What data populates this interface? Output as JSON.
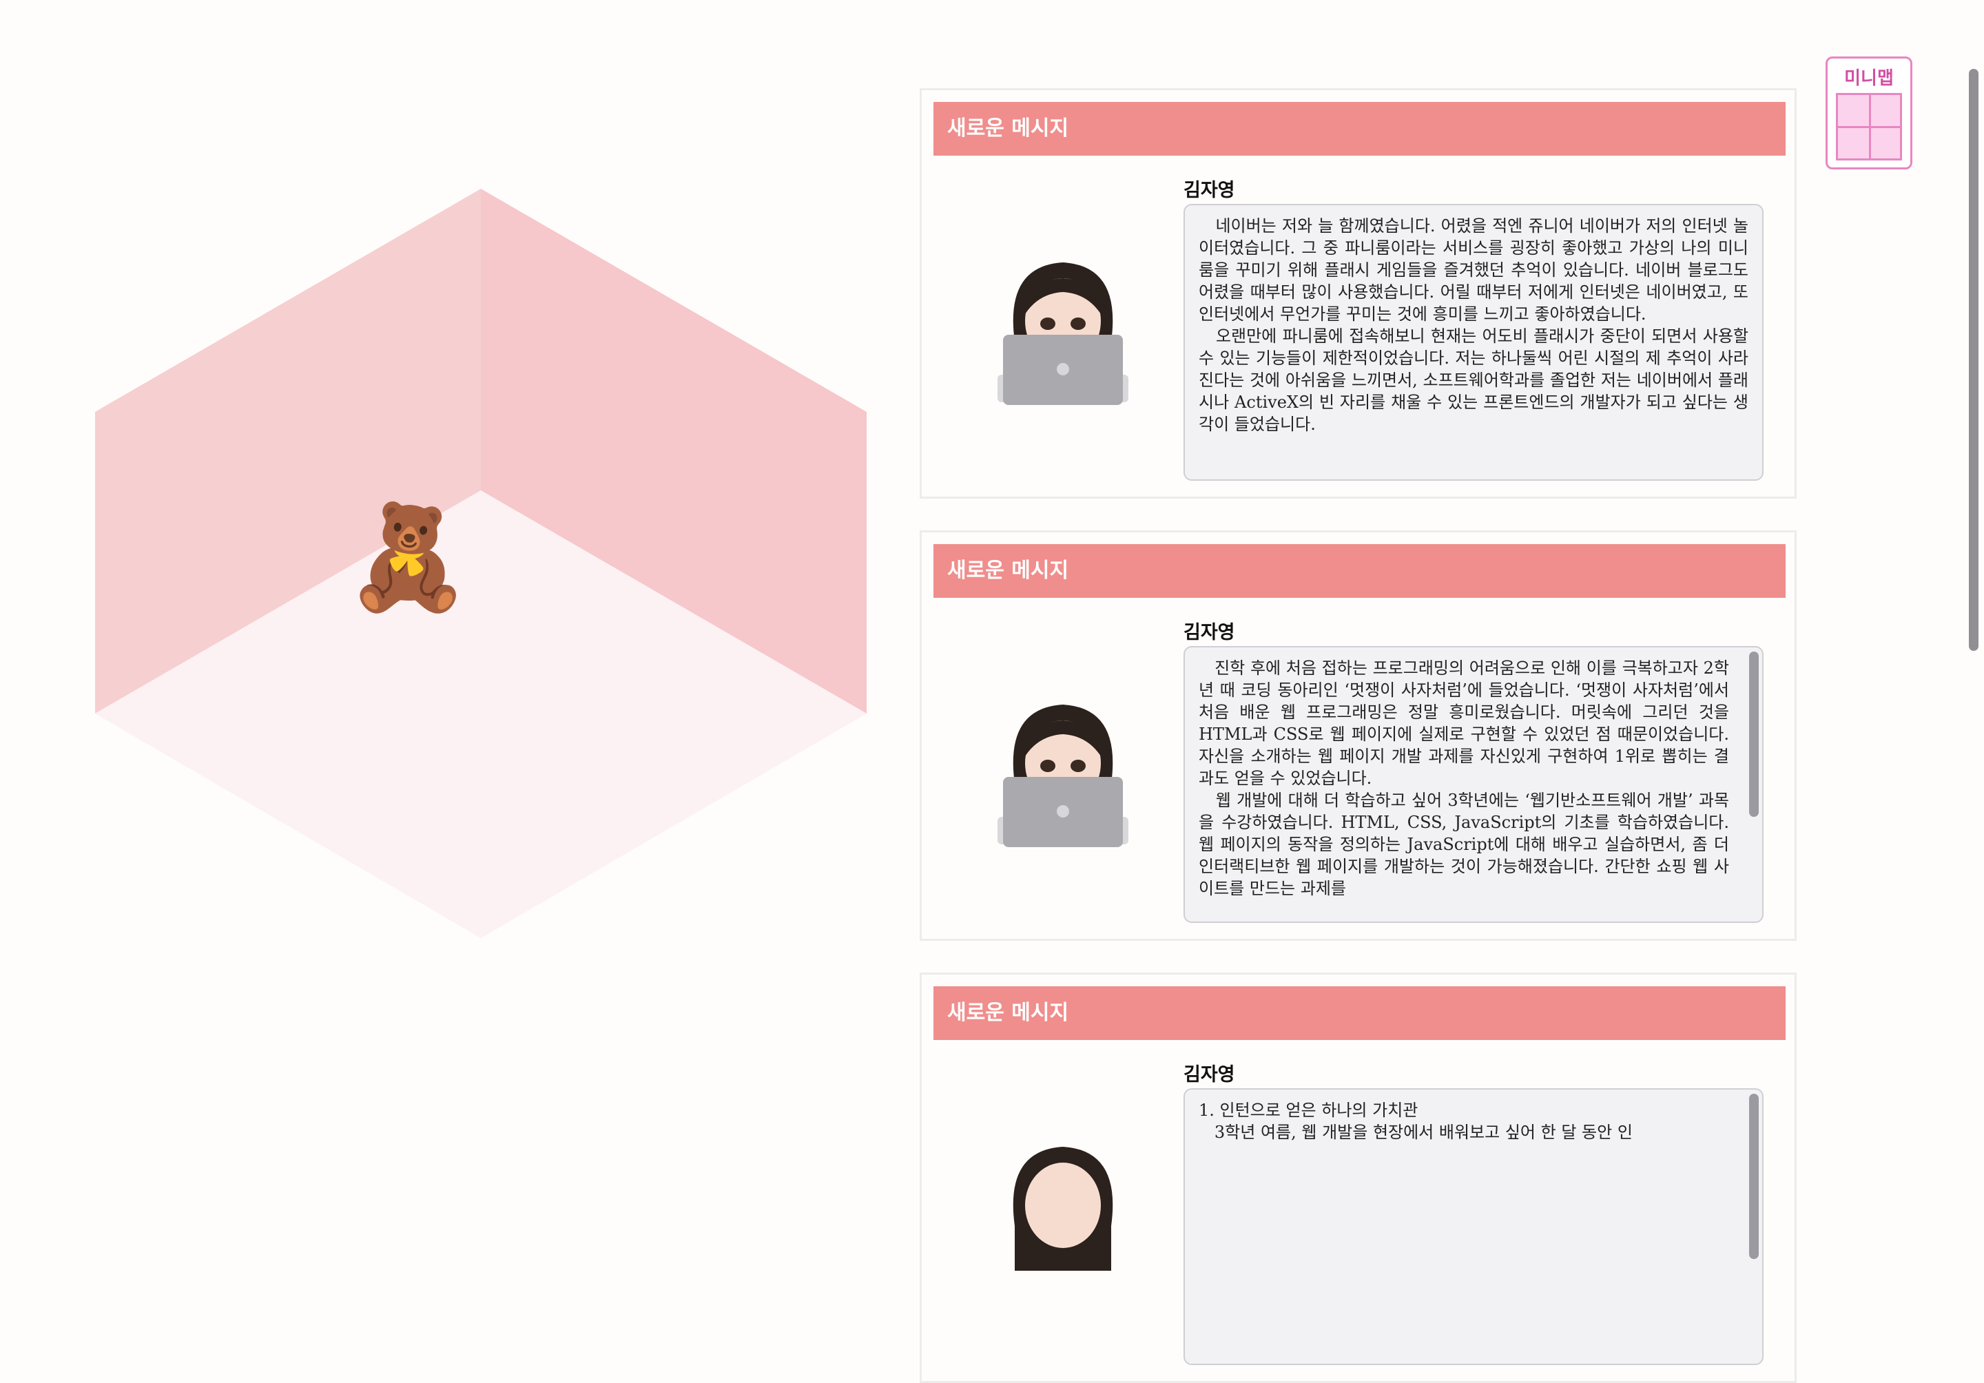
{
  "room": {
    "item_icon": "teddy-bear-icon",
    "item_glyph": "🧸"
  },
  "minimap": {
    "title": "미니맵"
  },
  "messages": [
    {
      "header": "새로운 메시지",
      "sender": "김자영",
      "avatar": "memoji-laptop-avatar",
      "text": "   네이버는 저와 늘 함께였습니다. 어렸을 적엔 쥬니어 네이버가 저의 인터넷 놀이터였습니다. 그 중 파니룸이라는 서비스를 굉장히 좋아했고 가상의 나의 미니 룸을 꾸미기 위해 플래시 게임들을 즐겨했던 추억이 있습니다. 네이버 블로그도 어렸을 때부터 많이 사용했습니다. 어릴 때부터 저에게 인터넷은 네이버였고, 또 인터넷에서 무언가를 꾸미는 것에 흥미를 느끼고 좋아하였습니다.\n   오랜만에 파니룸에 접속해보니 현재는 어도비 플래시가 중단이 되면서 사용할 수 있는 기능들이 제한적이었습니다. 저는 하나둘씩 어린 시절의 제 추억이 사라진다는 것에 아쉬움을 느끼면서, 소프트웨어학과를 졸업한 저는 네이버에서 플래시나 ActiveX의 빈 자리를 채울 수 있는 프론트엔드의 개발자가 되고 싶다는 생각이 들었습니다.",
      "scroll": false
    },
    {
      "header": "새로운 메시지",
      "sender": "김자영",
      "avatar": "memoji-laptop-avatar",
      "text": "   진학 후에 처음 접하는 프로그래밍의 어려움으로 인해 이를 극복하고자 2학년 때 코딩 동아리인 ‘멋쟁이 사자처럼’에 들었습니다. ‘멋쟁이 사자처럼’에서 처음 배운 웹 프로그래밍은 정말 흥미로웠습니다. 머릿속에 그리던 것을 HTML과 CSS로 웹 페이지에 실제로 구현할 수 있었던 점 때문이었습니다. 자신을 소개하는 웹 페이지 개발 과제를 자신있게 구현하여 1위로 뽑히는 결과도 얻을 수 있었습니다.\n   웹 개발에 대해 더 학습하고 싶어 3학년에는 ‘웹기반소프트웨어 개발’ 과목을 수강하였습니다. HTML, CSS, JavaScript의 기초를 학습하였습니다. 웹 페이지의 동작을 정의하는 JavaScript에 대해 배우고 실습하면서, 좀 더 인터랙티브한 웹 페이지를 개발하는 것이 가능해졌습니다. 간단한 쇼핑 웹 사이트를 만드는 과제를",
      "scroll": true
    },
    {
      "header": "새로운 메시지",
      "sender": "김자영",
      "avatar": "memoji-laptop-avatar",
      "text": "1. 인턴으로 얻은 하나의 가치관\n   3학년 여름, 웹 개발을 현장에서 배워보고 싶어 한 달 동안 인",
      "scroll": true
    }
  ]
}
